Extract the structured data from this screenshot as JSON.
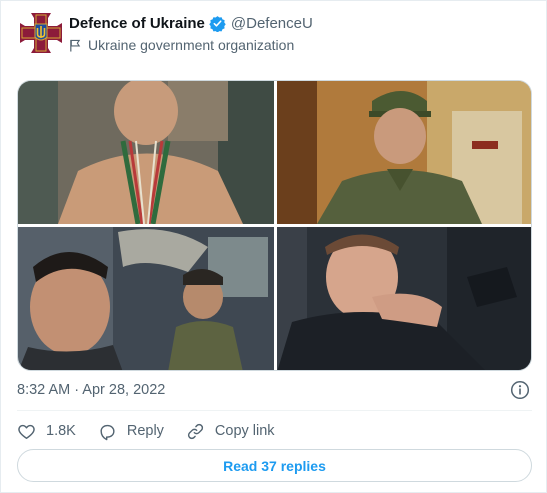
{
  "account": {
    "display_name": "Defence of Ukraine",
    "handle": "@DefenceU",
    "label": "Ukraine government organization",
    "avatar_icon": "ukraine-mod-emblem",
    "verified_icon": "verified-badge-icon"
  },
  "media": {
    "photos": [
      {
        "icon": "photo-soldier-shirtless-medals"
      },
      {
        "icon": "photo-soldier-cap-uniform"
      },
      {
        "icon": "photo-soldiers-vehicle-selfie"
      },
      {
        "icon": "photo-man-smiling-car"
      }
    ]
  },
  "tweet": {
    "timestamp": "8:32 AM · Apr 28, 2022"
  },
  "actions": {
    "like_count": "1.8K",
    "reply_label": "Reply",
    "copy_link_label": "Copy link"
  },
  "footer": {
    "read_replies_label": "Read 37 replies"
  },
  "colors": {
    "accent": "#1d9bf0",
    "muted_text": "#536471",
    "emblem_maroon": "#8c1b3a",
    "emblem_gold": "#d4a434"
  }
}
